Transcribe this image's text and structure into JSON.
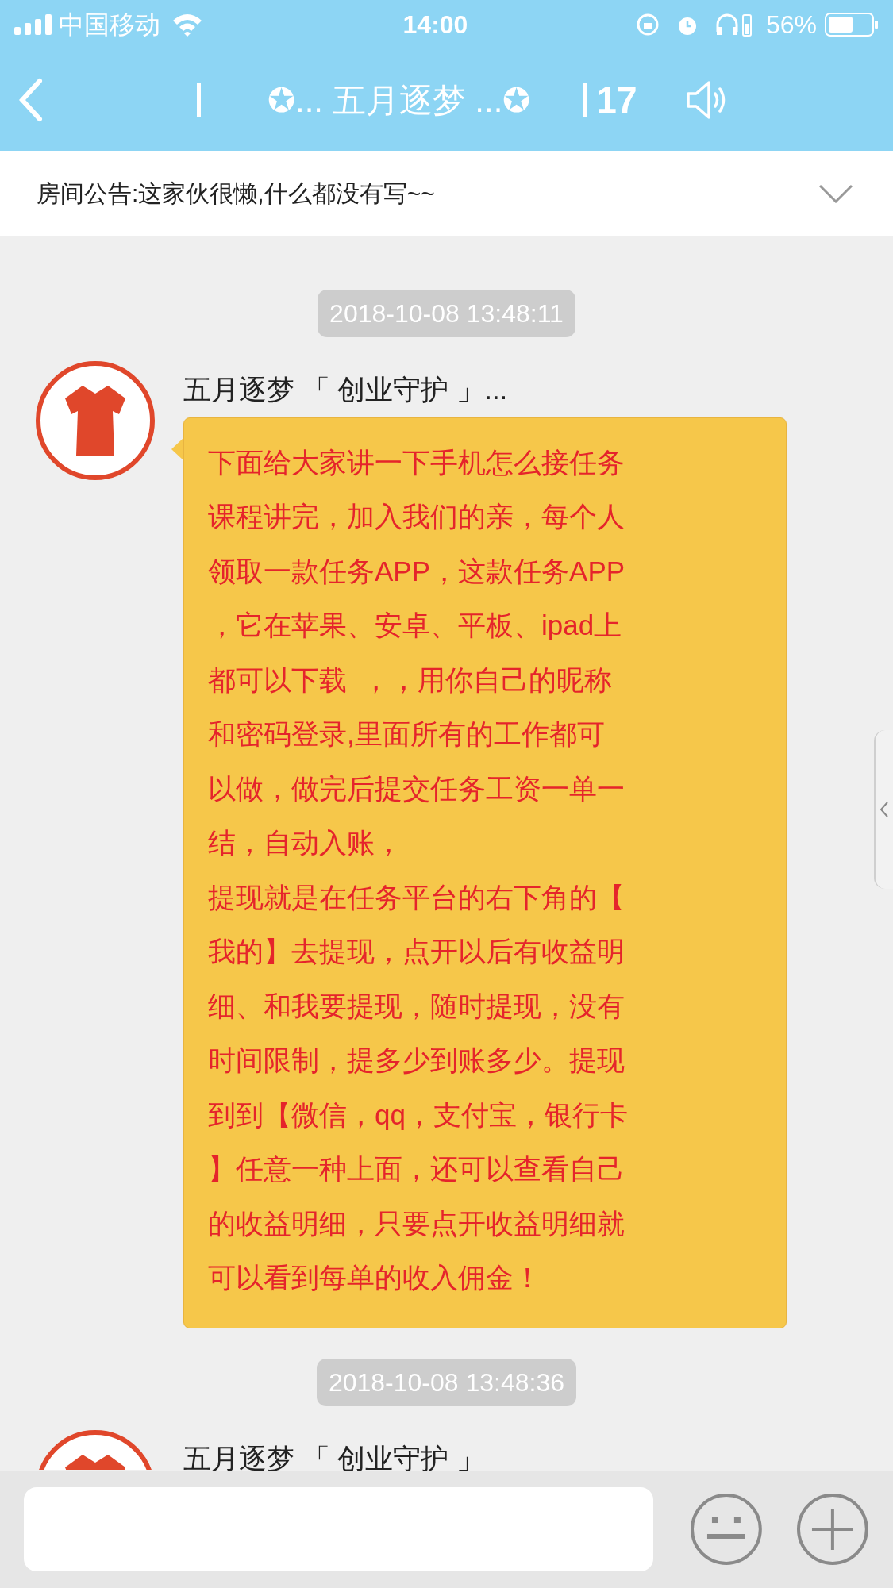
{
  "status_bar": {
    "carrier": "中国移动",
    "time": "14:00",
    "battery": "56%"
  },
  "header": {
    "title": "✪... 五月逐梦 ...✪",
    "member_count": "17"
  },
  "announcement": {
    "text": "房间公告:这家伙很懒,什么都没有写~~",
    "expanded": false
  },
  "messages": [
    {
      "kind": "message",
      "timestamp": "2018-10-08 13:48:11",
      "sender": "五月逐梦 「 创业守护 」...",
      "lines": [
        "下面给大家讲一下手机怎么接任务",
        "课程讲完，加入我们的亲，每个人",
        "领取一款任务APP，这款任务APP",
        "，它在苹果、安卓、平板、ipad上",
        "都可以下载  ，，用你自己的昵称",
        "和密码登录,里面所有的工作都可",
        "以做，做完后提交任务工资一单一",
        "结，自动入账，",
        "提现就是在任务平台的右下角的【",
        "我的】去提现，点开以后有收益明",
        "细、和我要提现，随时提现，没有",
        "时间限制，提多少到账多少。提现",
        "到到【微信，qq，支付宝，银行卡",
        "】任意一种上面，还可以查看自己",
        "的收益明细，只要点开收益明细就",
        "可以看到每单的收入佣金！"
      ]
    },
    {
      "kind": "partial",
      "timestamp": "2018-10-08 13:48:36",
      "sender": "五月逐梦 「 创业守护 」"
    }
  ]
}
